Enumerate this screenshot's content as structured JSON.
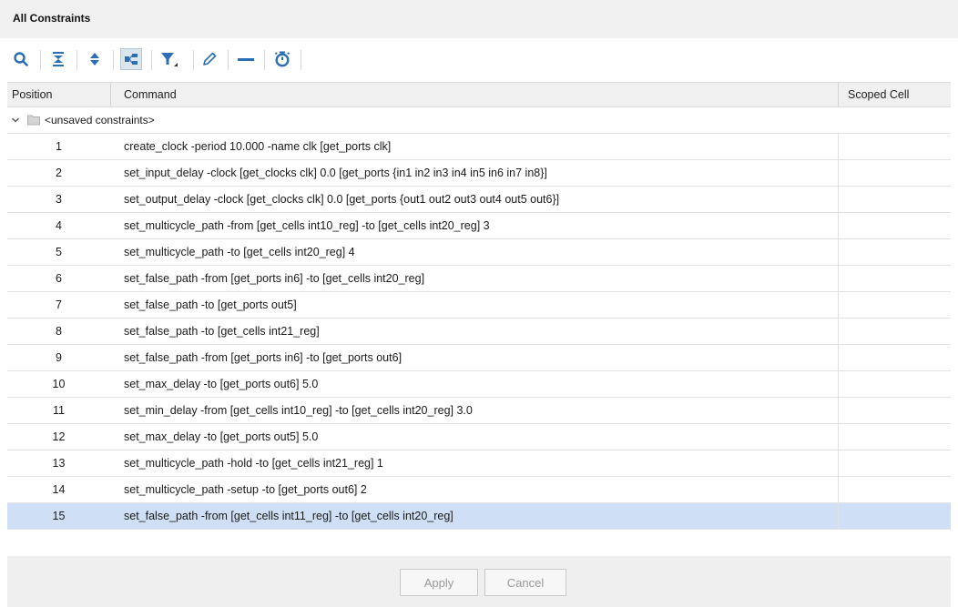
{
  "window": {
    "title": "All Constraints"
  },
  "toolbar": {
    "icons": [
      "search-icon",
      "collapse-all-icon",
      "expand-all-icon",
      "group-by-icon",
      "filter-icon",
      "edit-icon",
      "remove-icon",
      "timer-icon"
    ]
  },
  "table": {
    "columns": {
      "position": "Position",
      "command": "Command",
      "scoped_cell": "Scoped Cell"
    },
    "group_label": "<unsaved constraints>",
    "rows": [
      {
        "pos": "1",
        "cmd": "create_clock -period 10.000 -name clk [get_ports clk]",
        "scoped": ""
      },
      {
        "pos": "2",
        "cmd": "set_input_delay -clock [get_clocks clk] 0.0 [get_ports {in1 in2 in3 in4 in5 in6 in7 in8}]",
        "scoped": ""
      },
      {
        "pos": "3",
        "cmd": "set_output_delay -clock [get_clocks clk] 0.0 [get_ports {out1 out2 out3 out4 out5 out6}]",
        "scoped": ""
      },
      {
        "pos": "4",
        "cmd": "set_multicycle_path -from [get_cells int10_reg] -to [get_cells int20_reg] 3",
        "scoped": ""
      },
      {
        "pos": "5",
        "cmd": "set_multicycle_path -to [get_cells int20_reg] 4",
        "scoped": ""
      },
      {
        "pos": "6",
        "cmd": "set_false_path -from [get_ports in6] -to [get_cells int20_reg]",
        "scoped": ""
      },
      {
        "pos": "7",
        "cmd": "set_false_path -to [get_ports out5]",
        "scoped": ""
      },
      {
        "pos": "8",
        "cmd": "set_false_path -to [get_cells int21_reg]",
        "scoped": ""
      },
      {
        "pos": "9",
        "cmd": "set_false_path -from [get_ports in6] -to [get_ports out6]",
        "scoped": ""
      },
      {
        "pos": "10",
        "cmd": "set_max_delay -to [get_ports out6] 5.0",
        "scoped": ""
      },
      {
        "pos": "11",
        "cmd": "set_min_delay -from [get_cells int10_reg] -to [get_cells int20_reg] 3.0",
        "scoped": ""
      },
      {
        "pos": "12",
        "cmd": "set_max_delay -to [get_ports out5] 5.0",
        "scoped": ""
      },
      {
        "pos": "13",
        "cmd": "set_multicycle_path -hold -to [get_cells int21_reg] 1",
        "scoped": ""
      },
      {
        "pos": "14",
        "cmd": "set_multicycle_path -setup -to [get_ports out6] 2",
        "scoped": ""
      },
      {
        "pos": "15",
        "cmd": "set_false_path -from [get_cells int11_reg] -to [get_cells int20_reg]",
        "scoped": "",
        "selected": true
      }
    ]
  },
  "footer": {
    "apply_label": "Apply",
    "cancel_label": "Cancel",
    "buttons_enabled": false
  },
  "colors": {
    "accent_icon": "#2a6fb6",
    "selected_row": "#cfe0f6",
    "header_bg": "#f0f0f0"
  }
}
